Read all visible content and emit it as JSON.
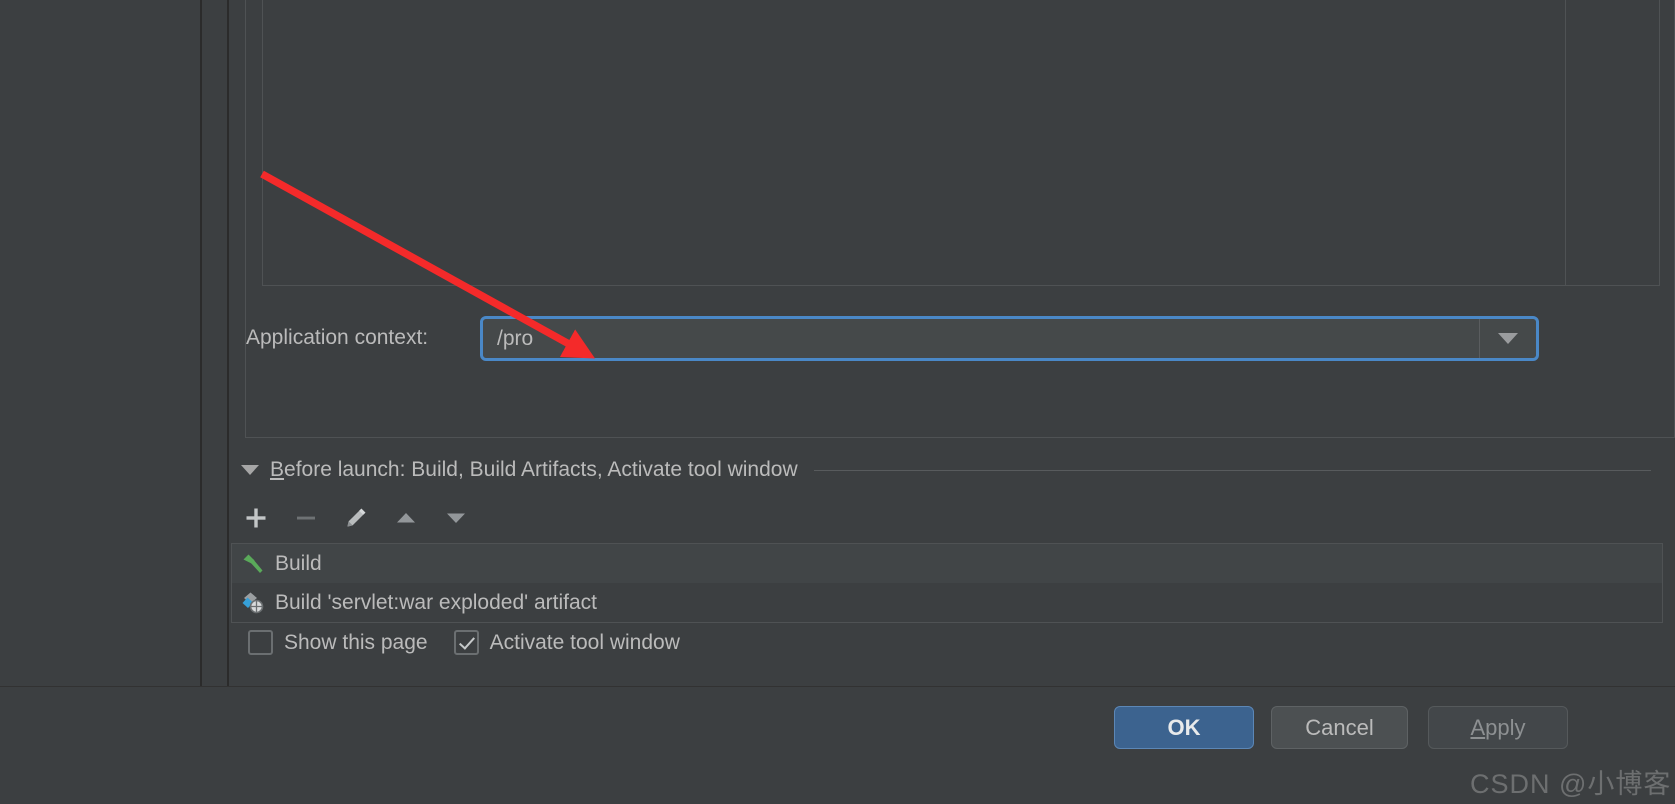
{
  "dialog": {
    "accent_color": "#4a88c7",
    "background_color": "#3c3f41",
    "text_color": "#bbbbbb"
  },
  "config_panel": {
    "app_context": {
      "label": "Application context:",
      "value": "/pro",
      "placeholder": "",
      "dropdown_icon": "chevron-down-icon"
    }
  },
  "before_launch": {
    "collapse_icon": "triangle-down-icon",
    "title_mnemonic": "B",
    "title_rest": "efore launch: Build, Build Artifacts, Activate tool window",
    "toolbar": [
      {
        "name": "add-task-button",
        "icon": "plus-icon",
        "enabled": true
      },
      {
        "name": "remove-task-button",
        "icon": "minus-icon",
        "enabled": false
      },
      {
        "name": "edit-task-button",
        "icon": "pencil-icon",
        "enabled": true
      },
      {
        "name": "move-up-button",
        "icon": "arrow-up-icon",
        "enabled": true
      },
      {
        "name": "move-down-button",
        "icon": "arrow-down-icon",
        "enabled": true
      }
    ],
    "tasks": [
      {
        "label": "Build",
        "icon": "hammer-icon"
      },
      {
        "label": "Build 'servlet:war exploded' artifact",
        "icon": "artifact-icon"
      }
    ],
    "options": [
      {
        "label": "Show this page",
        "checked": false
      },
      {
        "label": "Activate tool window",
        "checked": true
      }
    ]
  },
  "buttons": {
    "ok": "OK",
    "cancel": "Cancel",
    "apply_mnemonic": "A",
    "apply_rest": "pply"
  },
  "watermark": {
    "text": "CSDN @小博客"
  }
}
